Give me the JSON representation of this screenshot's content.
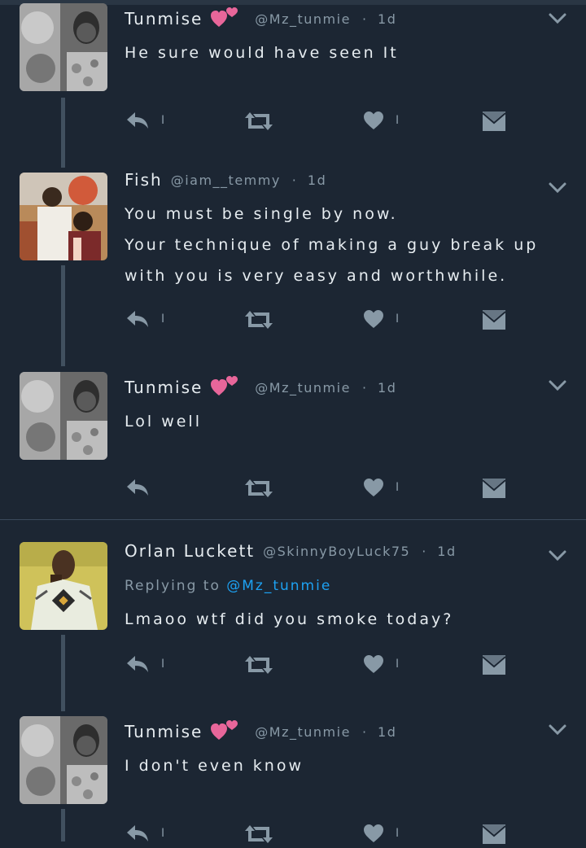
{
  "colors": {
    "background": "#1c2633",
    "text": "#e6ecf0",
    "muted": "#8899a6",
    "icon": "#8899a6",
    "mention": "#1da1f2",
    "emoji_heart": "#e8669a"
  },
  "icons": {
    "reply": "reply-arrow-icon",
    "retweet": "retweet-icon",
    "like": "heart-icon",
    "dm": "envelope-icon",
    "more": "chevron-down-icon",
    "name_emoji": "two-hearts-emoji"
  },
  "tweets": [
    {
      "name": "Tunmise",
      "handle": "@Mz_tunmie",
      "sep": "·",
      "time": "1d",
      "lines": [
        "He sure would have seen It"
      ],
      "reply_count": "I",
      "like_count": "I"
    },
    {
      "name": "Fish",
      "handle": "@iam__temmy",
      "sep": "·",
      "time": "1d",
      "lines": [
        "You must be single by now.",
        "Your technique of making a guy break up",
        "with you is very easy and worthwhile."
      ],
      "reply_count": "I",
      "like_count": "I"
    },
    {
      "name": "Tunmise",
      "handle": "@Mz_tunmie",
      "sep": "·",
      "time": "1d",
      "lines": [
        "Lol well"
      ],
      "like_count": "I"
    },
    {
      "name": "Orlan Luckett",
      "handle": "@SkinnyBoyLuck75",
      "sep": "·",
      "time": "1d",
      "replying_label": "Replying to",
      "replying_to": "@Mz_tunmie",
      "lines": [
        "Lmaoo wtf did you smoke today?"
      ],
      "reply_count": "I",
      "like_count": "I"
    },
    {
      "name": "Tunmise",
      "handle": "@Mz_tunmie",
      "sep": "·",
      "time": "1d",
      "lines": [
        "I don't even know"
      ],
      "reply_count": "I",
      "like_count": "I"
    }
  ]
}
